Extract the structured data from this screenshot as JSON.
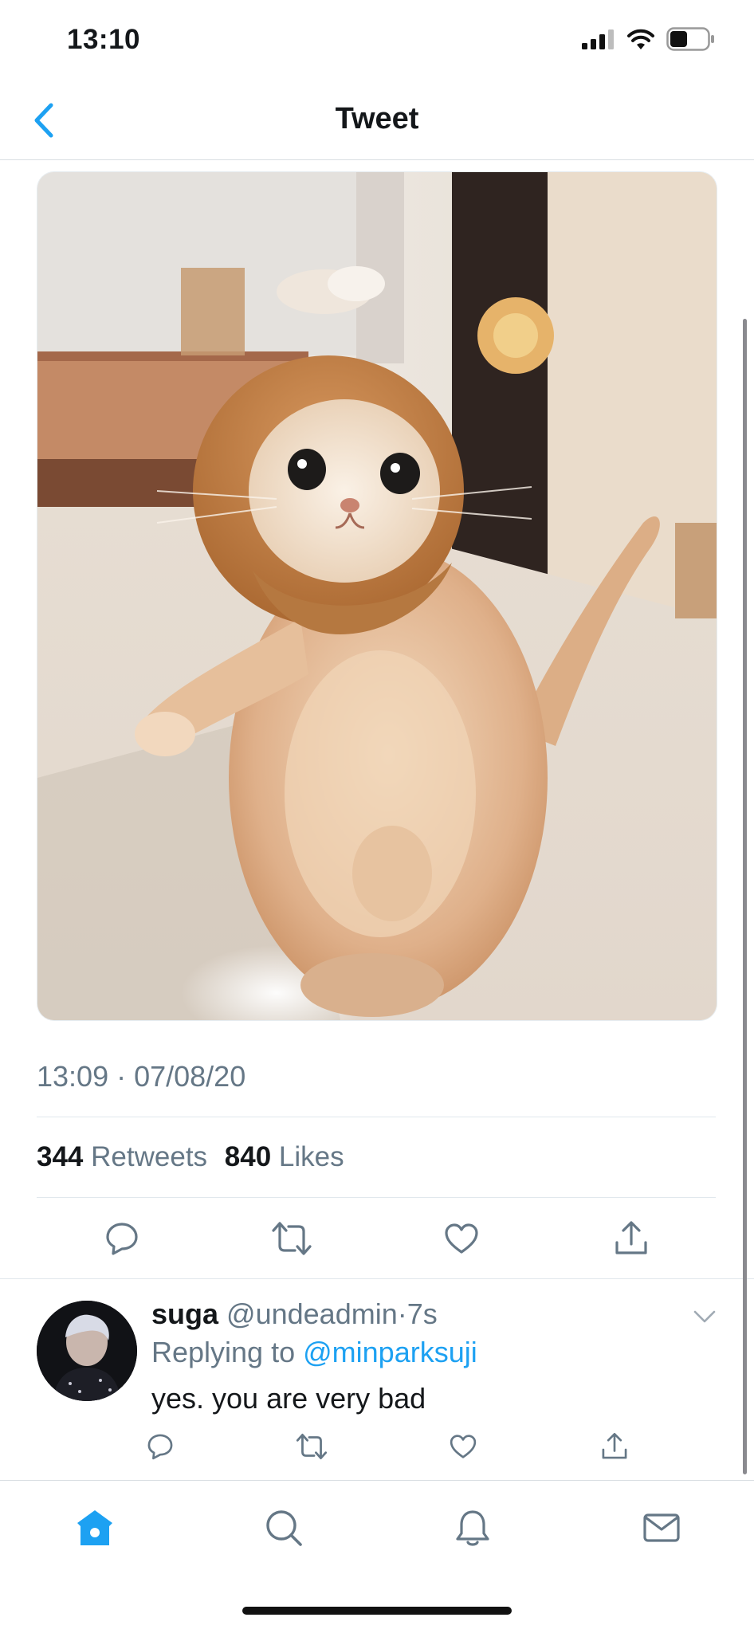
{
  "status_bar": {
    "time": "13:10",
    "battery_level": 0.45
  },
  "header": {
    "title": "Tweet",
    "back_icon": "chevron-left-icon"
  },
  "tweet": {
    "image_icon": "cat-in-bear-hat-photo",
    "timestamp": "13:09 · 07/08/20",
    "retweets_count": "344",
    "retweets_label": "Retweets",
    "likes_count": "840",
    "likes_label": "Likes",
    "actions": [
      "reply-icon",
      "retweet-icon",
      "like-icon",
      "share-icon"
    ]
  },
  "reply": {
    "name": "suga",
    "handle": "@undeadmin",
    "separator": "·",
    "time_ago": "7s",
    "replying_to_label": "Replying to",
    "replying_to_handle": "@minparksuji",
    "text": "yes. you are very bad"
  },
  "tab_bar": {
    "tabs": [
      "home-icon",
      "search-icon",
      "notifications-icon",
      "messages-icon"
    ],
    "active": "home-icon"
  },
  "colors": {
    "accent": "#1da1f2",
    "secondary_text": "#657786",
    "primary_text": "#14171a",
    "divider": "#e1e8ed"
  }
}
